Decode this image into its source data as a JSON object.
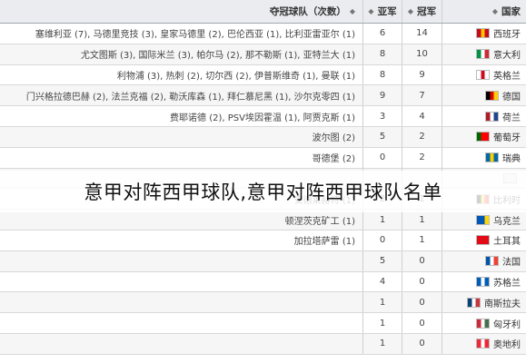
{
  "headers": {
    "club": "夺冠球队（次数）",
    "runners_up": "亚军",
    "winners": "冠军",
    "nation": "国家"
  },
  "rows": [
    {
      "club": "塞维利亚 (7), 马德里竞技 (3), 皇家马德里 (2), 巴伦西亚 (1), 比利亚雷亚尔 (1)",
      "ru": "6",
      "win": "14",
      "nat": "西班牙",
      "flag": [
        "#c60b1e",
        "#ffc400",
        "#c60b1e"
      ]
    },
    {
      "club": "尤文图斯 (3), 国际米兰 (3), 帕尔马 (2), 那不勒斯 (1), 亚特兰大 (1)",
      "ru": "8",
      "win": "10",
      "nat": "意大利",
      "flag": [
        "#009246",
        "#ffffff",
        "#ce2b37"
      ]
    },
    {
      "club": "利物浦 (3), 热刺 (2), 切尔西 (2), 伊普斯维奇 (1), 曼联 (1)",
      "ru": "8",
      "win": "9",
      "nat": "英格兰",
      "flag": [
        "#ffffff",
        "#cf081f",
        "#ffffff"
      ]
    },
    {
      "club": "门兴格拉德巴赫 (2), 法兰克福 (2), 勒沃库森 (1), 拜仁慕尼黑 (1), 沙尔克零四 (1)",
      "ru": "9",
      "win": "7",
      "nat": "德国",
      "flag": [
        "#000000",
        "#dd0000",
        "#ffce00"
      ]
    },
    {
      "club": "费耶诺德 (2), PSV埃因霍温 (1), 阿贾克斯 (1)",
      "ru": "3",
      "win": "4",
      "nat": "荷兰",
      "flag": [
        "#ae1c28",
        "#ffffff",
        "#21468b"
      ]
    },
    {
      "club": "波尔图 (2)",
      "ru": "5",
      "win": "2",
      "nat": "葡萄牙",
      "flag": [
        "#006600",
        "#ff0000",
        "#ff0000"
      ]
    },
    {
      "club": "哥德堡 (2)",
      "ru": "0",
      "win": "2",
      "nat": "瑞典",
      "flag": [
        "#006aa7",
        "#fecc00",
        "#006aa7"
      ]
    },
    {
      "club": "",
      "ru": "",
      "win": "",
      "nat": "",
      "flag": [
        "#e8e8e8",
        "#e8e8e8",
        "#e8e8e8"
      ]
    },
    {
      "club": "安德莱赫特 (1)",
      "ru": "2",
      "win": "1",
      "nat": "比利时",
      "flag": [
        "#000000",
        "#fdda24",
        "#ef3340"
      ]
    },
    {
      "club": "顿涅茨克矿工 (1)",
      "ru": "1",
      "win": "1",
      "nat": "乌克兰",
      "flag": [
        "#0057b7",
        "#0057b7",
        "#ffd700"
      ]
    },
    {
      "club": "加拉塔萨雷 (1)",
      "ru": "0",
      "win": "1",
      "nat": "土耳其",
      "flag": [
        "#e30a17",
        "#e30a17",
        "#e30a17"
      ]
    },
    {
      "club": "",
      "ru": "5",
      "win": "0",
      "nat": "法国",
      "flag": [
        "#0055a4",
        "#ffffff",
        "#ef4135"
      ]
    },
    {
      "club": "",
      "ru": "4",
      "win": "0",
      "nat": "苏格兰",
      "flag": [
        "#005eb8",
        "#ffffff",
        "#005eb8"
      ]
    },
    {
      "club": "",
      "ru": "1",
      "win": "0",
      "nat": "南斯拉夫",
      "flag": [
        "#0c4076",
        "#ffffff",
        "#c6363c"
      ]
    },
    {
      "club": "",
      "ru": "1",
      "win": "0",
      "nat": "匈牙利",
      "flag": [
        "#ce2939",
        "#ffffff",
        "#477050"
      ]
    },
    {
      "club": "",
      "ru": "1",
      "win": "0",
      "nat": "奥地利",
      "flag": [
        "#ed2939",
        "#ffffff",
        "#ed2939"
      ]
    }
  ],
  "overlay_title": "意甲对阵西甲球队,意甲对阵西甲球队名单"
}
